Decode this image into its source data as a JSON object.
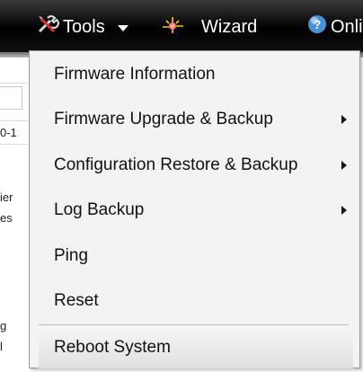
{
  "toolbar": {
    "tools_label": "Tools",
    "wizard_label": "Wizard",
    "online_label": "Onli"
  },
  "background_fragments": {
    "frag1": "0-1",
    "frag2": "ier",
    "frag3": "es",
    "frag4": "g",
    "frag5": "l"
  },
  "menu": {
    "items": [
      {
        "label": "Firmware Information",
        "submenu": false
      },
      {
        "label": "Firmware Upgrade & Backup",
        "submenu": true
      },
      {
        "label": "Configuration Restore & Backup",
        "submenu": true
      },
      {
        "label": "Log Backup",
        "submenu": true
      },
      {
        "label": "Ping",
        "submenu": false
      },
      {
        "label": "Reset",
        "submenu": false
      },
      {
        "label": "Reboot System",
        "submenu": false,
        "highlighted": true
      }
    ]
  },
  "colors": {
    "toolbar_bg": "#000000",
    "menu_bg": "#f5f2f6",
    "text": "#111111",
    "help_icon": "#4a8fd8"
  },
  "icons": {
    "tools": "tools-icon",
    "wizard": "wizard-icon",
    "online_help": "help-icon"
  }
}
